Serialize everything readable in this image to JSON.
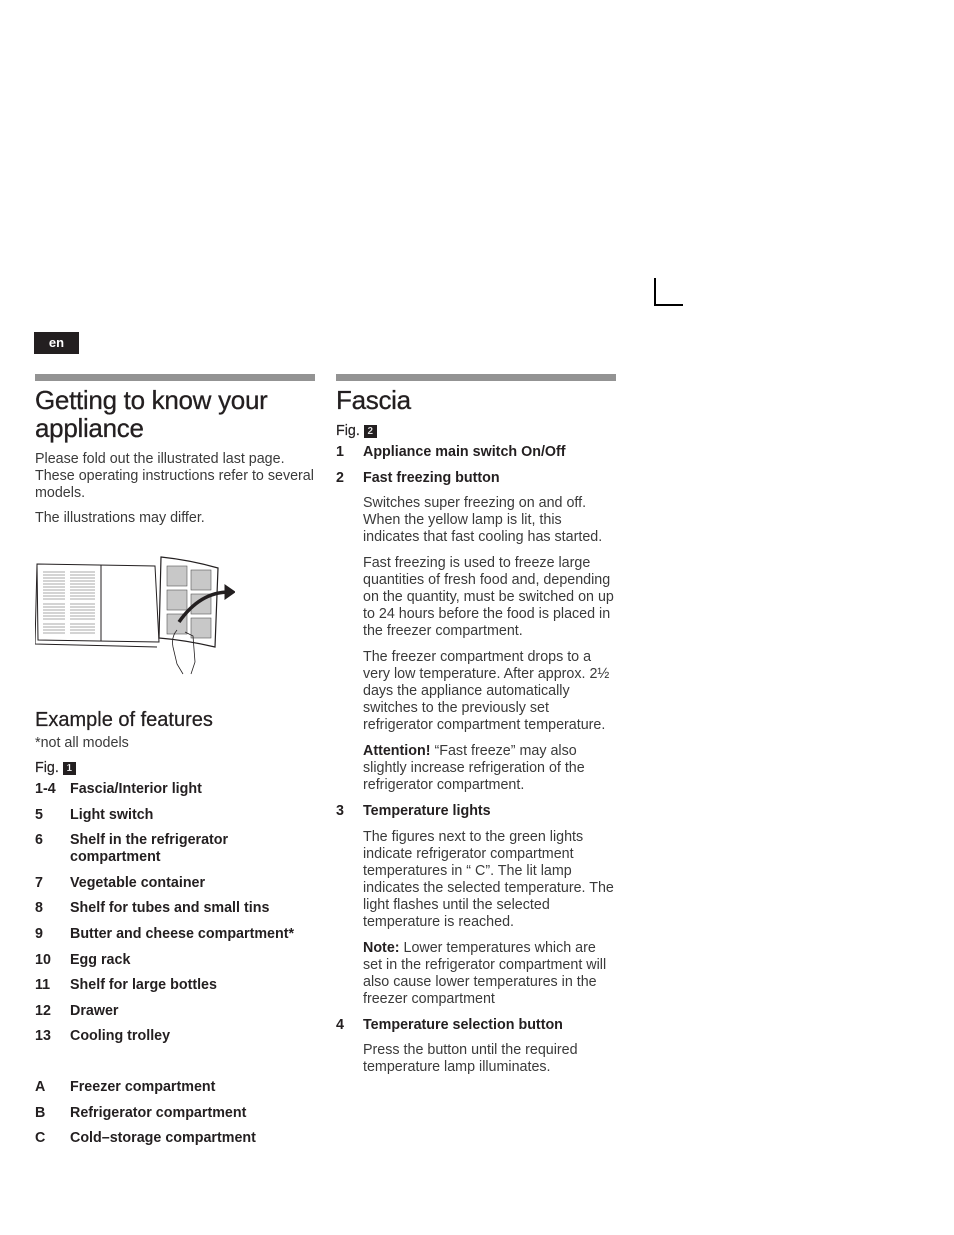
{
  "lang_tab": "en",
  "left": {
    "title": "Getting to know your appliance",
    "intro": [
      "Please fold out the illustrated last page. These operating instructions refer to several models.",
      "The illustrations may differ."
    ],
    "illustration": "fold-out-page-illustration",
    "features": {
      "heading": "Example of features",
      "note": "*not all models",
      "fig_label": "Fig.",
      "fig_num": "1",
      "items": [
        {
          "num": "1-4",
          "label": "Fascia/Interior light"
        },
        {
          "num": "5",
          "label": "Light switch"
        },
        {
          "num": "6",
          "label": "Shelf in the refrigerator compartment"
        },
        {
          "num": "7",
          "label": "Vegetable container"
        },
        {
          "num": "8",
          "label": "Shelf for tubes and small tins"
        },
        {
          "num": "9",
          "label": "Butter and cheese compartment*"
        },
        {
          "num": "10",
          "label": "Egg rack"
        },
        {
          "num": "11",
          "label": "Shelf for large bottles"
        },
        {
          "num": "12",
          "label": "Drawer"
        },
        {
          "num": "13",
          "label": "Cooling trolley"
        }
      ],
      "compartments": [
        {
          "num": "A",
          "label": "Freezer compartment"
        },
        {
          "num": "B",
          "label": "Refrigerator compartment"
        },
        {
          "num": "C",
          "label": "Cold–storage compartment"
        }
      ]
    }
  },
  "mid": {
    "title": "Fascia",
    "fig_label": "Fig.",
    "fig_num": "2",
    "item1": {
      "num": "1",
      "label": "Appliance main switch On/Off"
    },
    "item2": {
      "num": "2",
      "label": "Fast freezing button",
      "p1": "Switches super freezing on and off. When the yellow lamp is lit, this indicates that fast cooling has started.",
      "p2": "Fast freezing is used to freeze large quantities of fresh food and, depending on the quantity, must be switched on up to 24 hours before the food is placed in the freezer compartment.",
      "p3": "The freezer compartment drops to a very low temperature. After approx. 2½ days the appliance automatically switches to the previously set refrigerator compartment temperature.",
      "attention_label": "Attention!",
      "attention_text": " “Fast freeze” may also slightly increase refrigeration of the refrigerator compartment."
    },
    "item3": {
      "num": "3",
      "label": "Temperature lights",
      "p1": "The figures next to the green lights indicate refrigerator compartment temperatures in “ C”. The lit lamp indicates the selected temperature. The light flashes until the selected temperature is reached.",
      "note_label": "Note:",
      "note_text": " Lower temperatures which are set in the refrigerator compartment will also cause lower temperatures in the freezer compartment"
    },
    "item4": {
      "num": "4",
      "label": "Temperature selection button",
      "p1": "Press the button until the required temperature lamp illuminates."
    }
  }
}
